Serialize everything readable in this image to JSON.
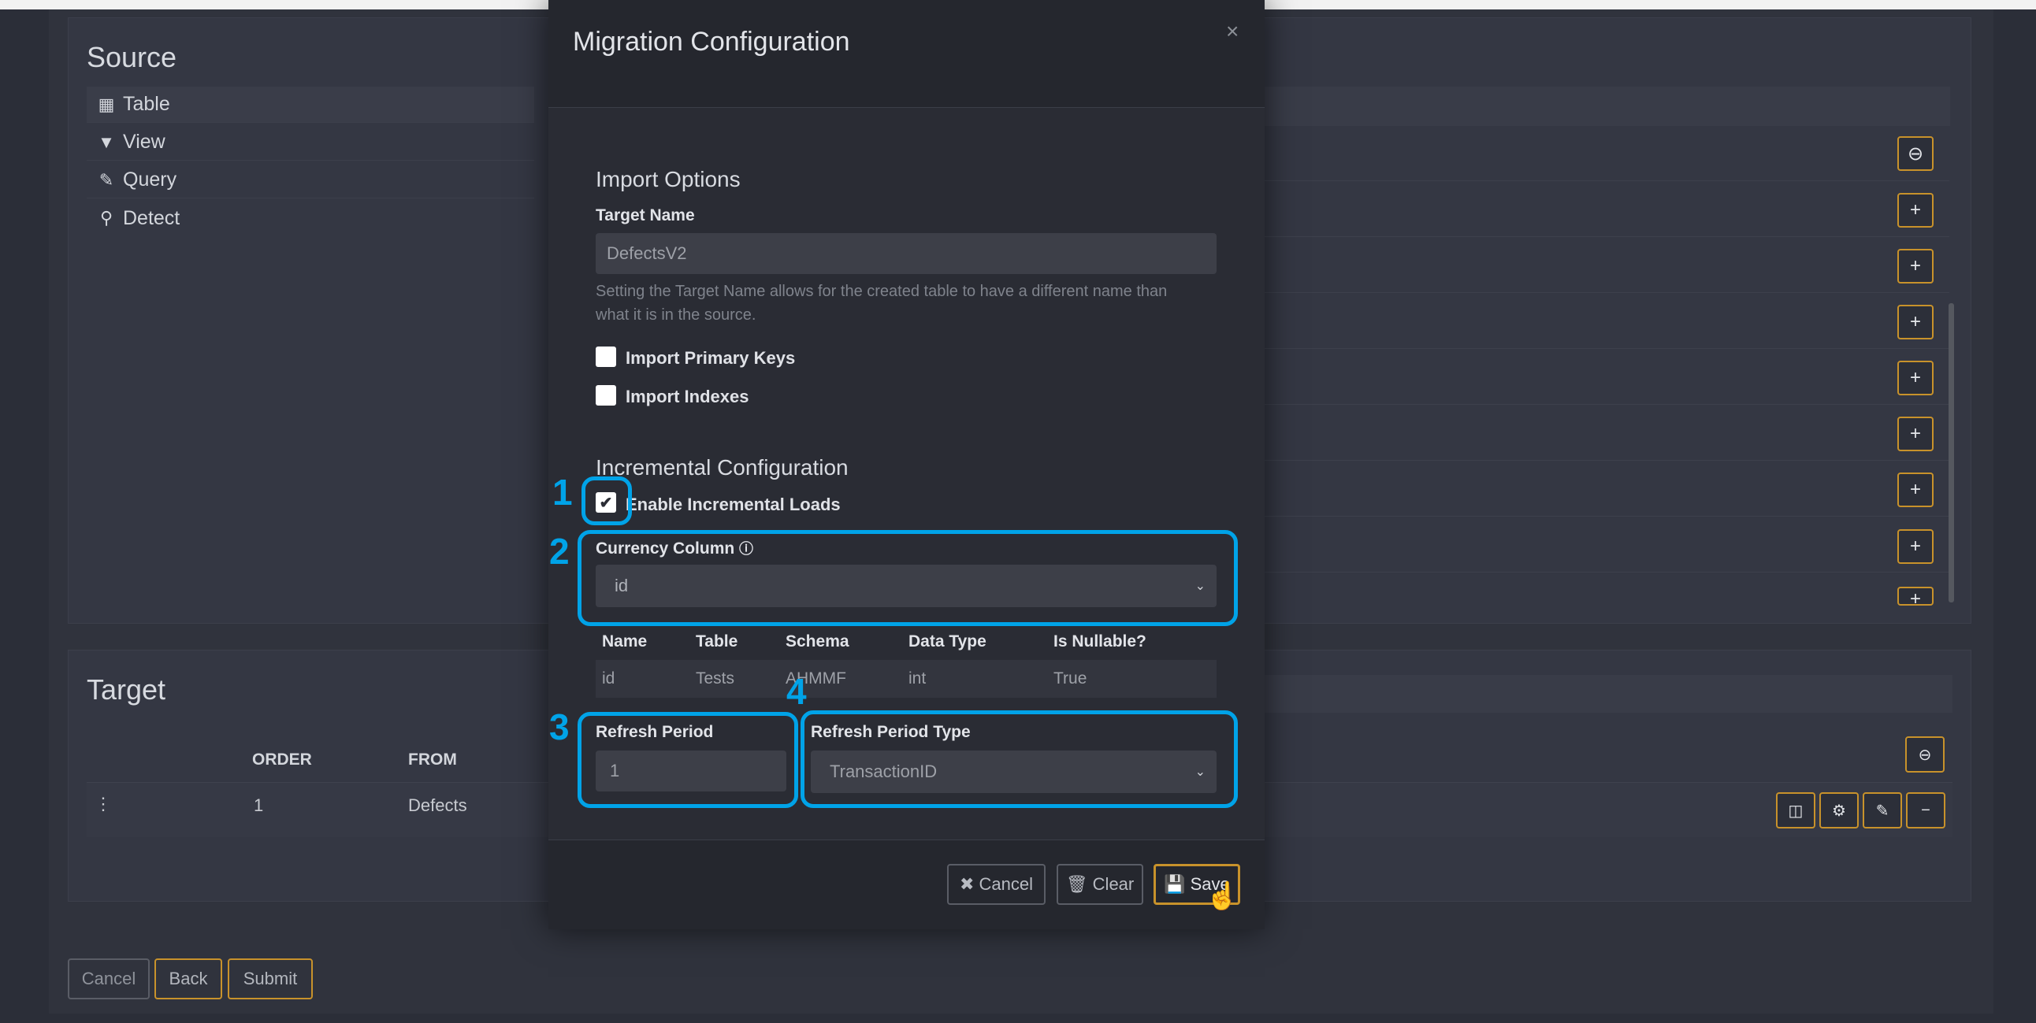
{
  "source": {
    "title": "Source",
    "items": [
      {
        "icon": "table-icon",
        "label": "Table"
      },
      {
        "icon": "filter-icon",
        "label": "View"
      },
      {
        "icon": "edit-icon",
        "label": "Query"
      },
      {
        "icon": "search-icon",
        "label": "Detect"
      }
    ]
  },
  "target": {
    "title": "Target",
    "columns": [
      "ORDER",
      "FROM"
    ],
    "row": {
      "order": "1",
      "from": "Defects"
    }
  },
  "bottom_buttons": {
    "cancel": "Cancel",
    "back": "Back",
    "submit": "Submit"
  },
  "modal": {
    "title": "Migration Configuration",
    "close": "×",
    "import_options": {
      "title": "Import Options",
      "target_name_label": "Target Name",
      "target_name_value": "DefectsV2",
      "help_line1": "Setting the Target Name allows for the created table to have a different name than",
      "help_line2": "what it is in the source.",
      "import_primary_keys": "Import Primary Keys",
      "import_indexes": "Import Indexes"
    },
    "incremental": {
      "title": "Incremental Configuration",
      "enable_label": "Enable Incremental Loads",
      "enable_checked": true,
      "currency_label": "Currency Column",
      "currency_value": "id",
      "table": {
        "headers": [
          "Name",
          "Table",
          "Schema",
          "Data Type",
          "Is Nullable?"
        ],
        "row": [
          "id",
          "Tests",
          "AHMMF",
          "int",
          "True"
        ]
      },
      "refresh_period_label": "Refresh Period",
      "refresh_period_value": "1",
      "refresh_type_label": "Refresh Period Type",
      "refresh_type_value": "TransactionID"
    },
    "footer": {
      "cancel": "Cancel",
      "clear": "Clear",
      "save": "Save"
    }
  },
  "annotations": [
    "1",
    "2",
    "3",
    "4"
  ],
  "colors": {
    "accent": "#c8922b",
    "highlight": "#00a3e8",
    "background": "#2b2e38"
  }
}
